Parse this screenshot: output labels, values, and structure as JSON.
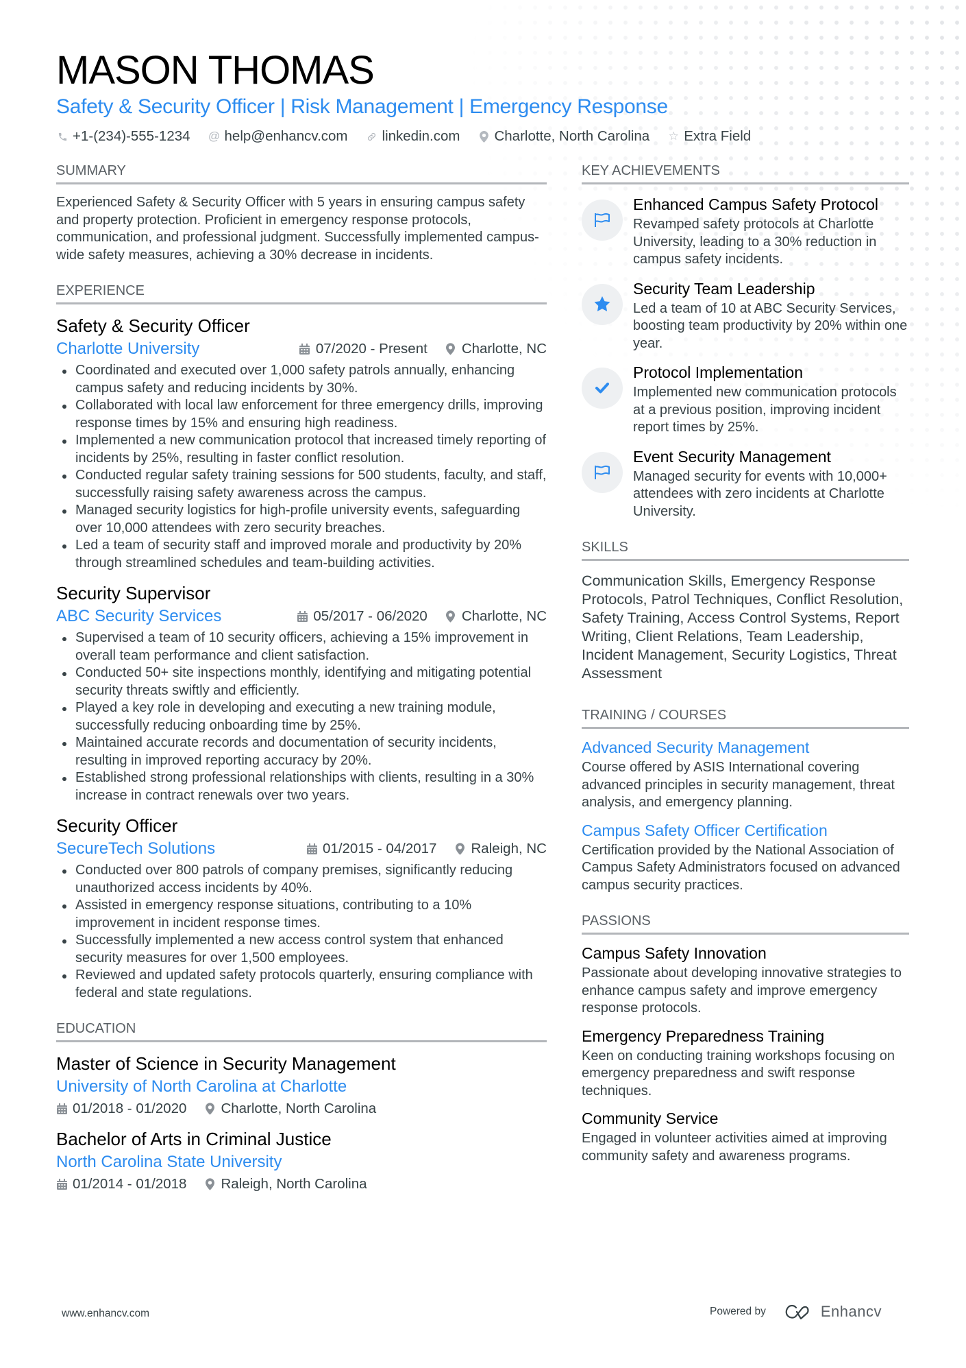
{
  "header": {
    "name": "MASON THOMAS",
    "subtitle": "Safety & Security Officer | Risk Management | Emergency Response",
    "contacts": [
      {
        "icon": "phone-icon",
        "text": "+1-(234)-555-1234"
      },
      {
        "icon": "at-icon",
        "text": "help@enhancv.com"
      },
      {
        "icon": "link-icon",
        "text": "linkedin.com"
      },
      {
        "icon": "location-icon",
        "text": "Charlotte, North Carolina"
      },
      {
        "icon": "star-icon",
        "text": "Extra Field"
      }
    ]
  },
  "summary": {
    "title": "SUMMARY",
    "text": "Experienced Safety & Security Officer with 5 years in ensuring campus safety and property protection. Proficient in emergency response protocols, communication, and professional judgment. Successfully implemented campus-wide safety measures, achieving a 30% decrease in incidents."
  },
  "experience": {
    "title": "EXPERIENCE",
    "jobs": [
      {
        "title": "Safety & Security Officer",
        "company": "Charlotte University",
        "dates": "07/2020 - Present",
        "location": "Charlotte, NC",
        "bullets": [
          "Coordinated and executed over 1,000 safety patrols annually, enhancing campus safety and reducing incidents by 30%.",
          "Collaborated with local law enforcement for three emergency drills, improving response times by 15% and ensuring high readiness.",
          "Implemented a new communication protocol that increased timely reporting of incidents by 25%, resulting in faster conflict resolution.",
          "Conducted regular safety training sessions for 500 students, faculty, and staff, successfully raising safety awareness across the campus.",
          "Managed security logistics for high-profile university events, safeguarding over 10,000 attendees with zero security breaches.",
          "Led a team of security staff and improved morale and productivity by 20% through streamlined schedules and team-building activities."
        ]
      },
      {
        "title": "Security Supervisor",
        "company": "ABC Security Services",
        "dates": "05/2017 - 06/2020",
        "location": "Charlotte, NC",
        "bullets": [
          "Supervised a team of 10 security officers, achieving a 15% improvement in overall team performance and client satisfaction.",
          "Conducted 50+ site inspections monthly, identifying and mitigating potential security threats swiftly and efficiently.",
          "Played a key role in developing and executing a new training module, successfully reducing onboarding time by 25%.",
          "Maintained accurate records and documentation of security incidents, resulting in improved reporting accuracy by 20%.",
          "Established strong professional relationships with clients, resulting in a 30% increase in contract renewals over two years."
        ]
      },
      {
        "title": "Security Officer",
        "company": "SecureTech Solutions",
        "dates": "01/2015 - 04/2017",
        "location": "Raleigh, NC",
        "bullets": [
          "Conducted over 800 patrols of company premises, significantly reducing unauthorized access incidents by 40%.",
          "Assisted in emergency response situations, contributing to a 10% improvement in incident response times.",
          "Successfully implemented a new access control system that enhanced security measures for over 1,500 employees.",
          "Reviewed and updated safety protocols quarterly, ensuring compliance with federal and state regulations."
        ]
      }
    ]
  },
  "education": {
    "title": "EDUCATION",
    "items": [
      {
        "degree": "Master of Science in Security Management",
        "school": "University of North Carolina at Charlotte",
        "dates": "01/2018 - 01/2020",
        "location": "Charlotte, North Carolina"
      },
      {
        "degree": "Bachelor of Arts in Criminal Justice",
        "school": "North Carolina State University",
        "dates": "01/2014 - 01/2018",
        "location": "Raleigh, North Carolina"
      }
    ]
  },
  "achievements": {
    "title": "KEY ACHIEVEMENTS",
    "items": [
      {
        "icon": "flag-icon",
        "title": "Enhanced Campus Safety Protocol",
        "desc": "Revamped safety protocols at Charlotte University, leading to a 30% reduction in campus safety incidents."
      },
      {
        "icon": "star-icon",
        "title": "Security Team Leadership",
        "desc": "Led a team of 10 at ABC Security Services, boosting team productivity by 20% within one year."
      },
      {
        "icon": "check-icon",
        "title": "Protocol Implementation",
        "desc": "Implemented new communication protocols at a previous position, improving incident report times by 25%."
      },
      {
        "icon": "flag-icon",
        "title": "Event Security Management",
        "desc": "Managed security for events with 10,000+ attendees with zero incidents at Charlotte University."
      }
    ]
  },
  "skills": {
    "title": "SKILLS",
    "text": "Communication Skills, Emergency Response Protocols, Patrol Techniques, Conflict Resolution, Safety Training, Access Control Systems, Report Writing, Client Relations, Team Leadership, Incident Management, Security Logistics, Threat Assessment"
  },
  "training": {
    "title": "TRAINING / COURSES",
    "items": [
      {
        "title": "Advanced Security Management",
        "desc": "Course offered by ASIS International covering advanced principles in security management, threat analysis, and emergency planning."
      },
      {
        "title": "Campus Safety Officer Certification",
        "desc": "Certification provided by the National Association of Campus Safety Administrators focused on advanced campus security practices."
      }
    ]
  },
  "passions": {
    "title": "PASSIONS",
    "items": [
      {
        "title": "Campus Safety Innovation",
        "desc": "Passionate about developing innovative strategies to enhance campus safety and improve emergency response protocols."
      },
      {
        "title": "Emergency Preparedness Training",
        "desc": "Keen on conducting training workshops focusing on emergency preparedness and swift response techniques."
      },
      {
        "title": "Community Service",
        "desc": "Engaged in volunteer activities aimed at improving community safety and awareness programs."
      }
    ]
  },
  "footer": {
    "website": "www.enhancv.com",
    "powered_by": "Powered by",
    "brand": "Enhancv"
  },
  "colors": {
    "accent": "#2d8cf0",
    "text": "#384347",
    "heading": "#000000",
    "section_title": "#5b6166",
    "rule": "#b3b6ba",
    "icon_circle": "#eef0f2"
  }
}
